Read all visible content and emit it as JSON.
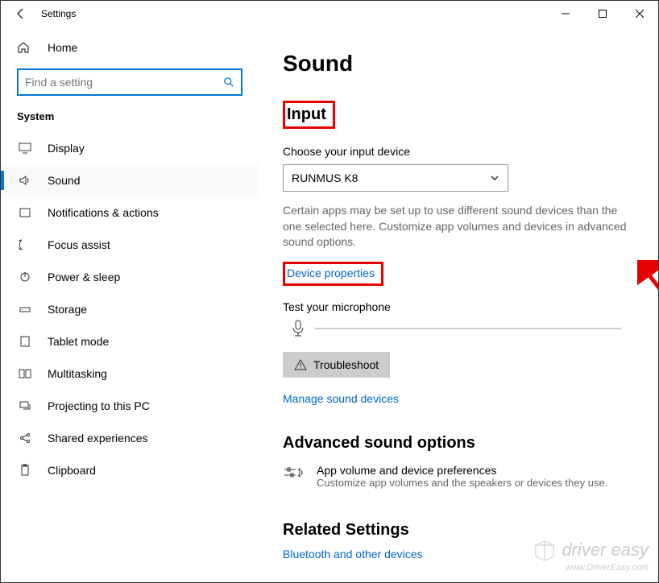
{
  "titlebar": {
    "title": "Settings"
  },
  "sidebar": {
    "home": "Home",
    "search_placeholder": "Find a setting",
    "section": "System",
    "items": [
      {
        "label": "Display"
      },
      {
        "label": "Sound"
      },
      {
        "label": "Notifications & actions"
      },
      {
        "label": "Focus assist"
      },
      {
        "label": "Power & sleep"
      },
      {
        "label": "Storage"
      },
      {
        "label": "Tablet mode"
      },
      {
        "label": "Multitasking"
      },
      {
        "label": "Projecting to this PC"
      },
      {
        "label": "Shared experiences"
      },
      {
        "label": "Clipboard"
      }
    ]
  },
  "main": {
    "heading": "Sound",
    "input_heading": "Input",
    "choose_label": "Choose your input device",
    "device": "RUNMUS K8",
    "desc": "Certain apps may be set up to use different sound devices than the one selected here. Customize app volumes and devices in advanced sound options.",
    "device_properties": "Device properties",
    "test_label": "Test your microphone",
    "troubleshoot": "Troubleshoot",
    "manage": "Manage sound devices",
    "advanced_heading": "Advanced sound options",
    "app_vol_title": "App volume and device preferences",
    "app_vol_desc": "Customize app volumes and the speakers or devices they use.",
    "related_heading": "Related Settings",
    "bluetooth": "Bluetooth and other devices"
  },
  "watermark": {
    "brand": "driver easy",
    "url": "www.DriverEasy.com"
  }
}
